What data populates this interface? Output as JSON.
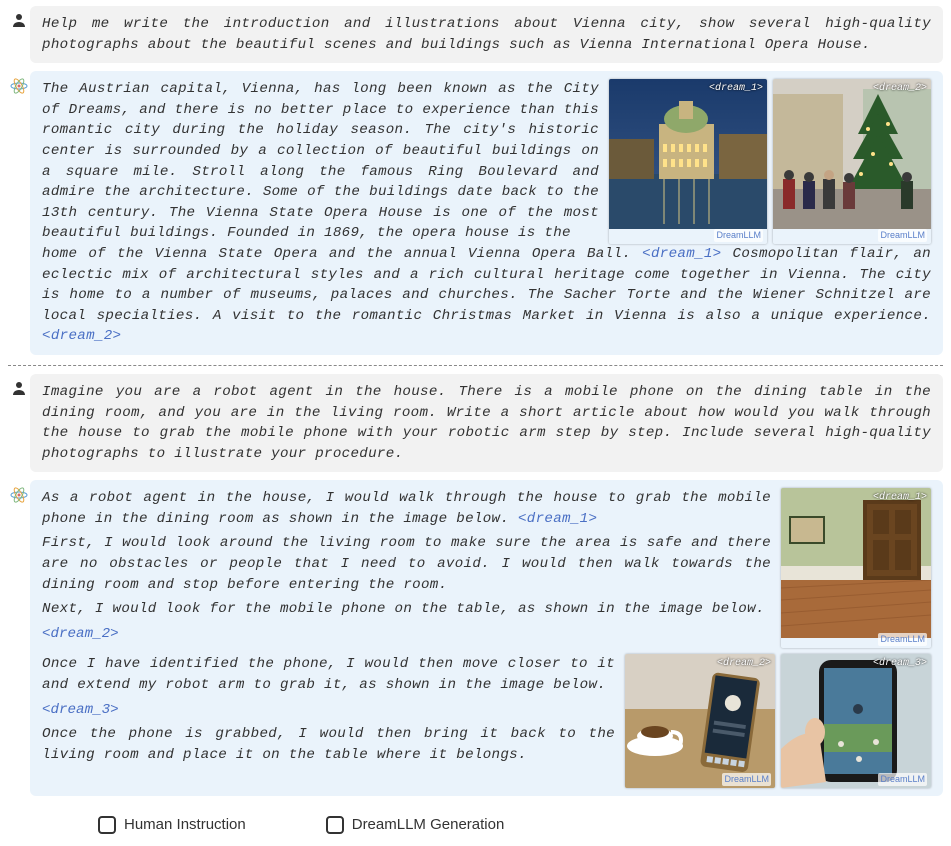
{
  "conv1": {
    "user": "Help me write the introduction and illustrations about Vienna city, show several high-quality photographs about the beautiful scenes and buildings such as Vienna International Opera House.",
    "ai_text_a": "The Austrian capital, Vienna, has long been known as the City of Dreams, and there is no better place to experience than this romantic city during the holiday season. The city's historic center is surrounded by a collection of beautiful buildings on a square mile. Stroll along the famous Ring Boulevard and admire the architecture. Some of the buildings date back to the 13th century. The Vienna State Opera House is one of the most beautiful buildings. Founded in 1869, the opera house is the",
    "ai_text_b_1": "home  of the Vienna State Opera and the annual Vienna Opera Ball. ",
    "ai_text_b_ref1": "<dream_1>",
    "ai_text_b_2": " Cosmopolitan flair, an eclectic mix of architectural styles and a rich cultural heritage come together in Vienna. The city is home to a number of museums, palaces and churches. The Sacher Torte and the Wiener Schnitzel are local specialties. A visit to the romantic Christmas Market in Vienna is also a unique experience. ",
    "ai_text_b_ref2": "<dream_2>",
    "img1_tag": "<dream_1>",
    "img2_tag": "<dream_2>",
    "watermark": "DreamLLM"
  },
  "conv2": {
    "user": "Imagine you are a robot agent in the house. There is a mobile phone on the dining table in the dining room, and you are in the living room. Write a short article about how would you walk through the house to grab the mobile phone with your robotic arm step by step. Include several high-quality photographs to illustrate your procedure.",
    "p1_a": "As a robot agent in the house, I would walk through the house to grab the mobile phone in the dining room as shown in the image below. ",
    "p1_ref": "<dream_1>",
    "p2": "First, I would look around the living room to make sure the area is safe and there are no obstacles or people that I need to avoid. I would then walk towards the dining room and stop before entering the room.",
    "p3_a": "Next, I would look for the mobile phone on the table, as shown in the image below. ",
    "p3_ref": "<dream_2>",
    "p4_a": "Once I have identified the phone, I would then move closer to it and extend my robot arm to grab it, as shown in the image below. ",
    "p4_ref": "<dream_3>",
    "p5": "Once the phone is grabbed, I would then bring it back to the living room and place it on the table where it belongs.",
    "img1_tag": "<dream_1>",
    "img2_tag": "<dream_2>",
    "img3_tag": "<dream_3>",
    "watermark": "DreamLLM"
  },
  "legend": {
    "human": "Human Instruction",
    "ai": "DreamLLM Generation"
  }
}
